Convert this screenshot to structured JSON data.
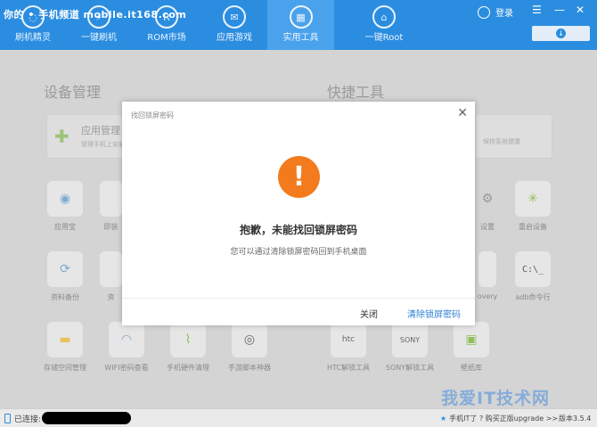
{
  "watermark": "你的 • 手机频道 mobile.it168.com",
  "nav": [
    {
      "label": "刷机精灵",
      "icon": "circle-icon"
    },
    {
      "label": "一键刷机",
      "icon": "flash-icon"
    },
    {
      "label": "ROM市场",
      "icon": "rom-icon"
    },
    {
      "label": "应用游戏",
      "icon": "mail-icon"
    },
    {
      "label": "实用工具",
      "icon": "grid-icon"
    },
    {
      "label": "一键Root",
      "icon": "root-icon"
    }
  ],
  "header": {
    "login_label": "登录"
  },
  "background": {
    "left_title": "设备管理",
    "right_title": "快捷工具",
    "card_title": "应用管理",
    "card_sub": "管理手机上安装",
    "right_card_sub": "保持系统健康",
    "tiles": [
      {
        "label": "应用宝",
        "icon": "app-store-icon"
      },
      {
        "label": "即装",
        "icon": "install-icon"
      },
      {
        "label": "资料备份",
        "icon": "backup-icon"
      },
      {
        "label": "资",
        "icon": "restore-icon"
      },
      {
        "label": "存储空间管理",
        "icon": "folder-icon"
      },
      {
        "label": "WIFI密码查看",
        "icon": "wifi-icon"
      },
      {
        "label": "手机硬件清理",
        "icon": "broom-icon"
      },
      {
        "label": "手游脚本神器",
        "icon": "gamepad-icon"
      },
      {
        "label": "HTC解锁工具",
        "icon": "htc-icon"
      },
      {
        "label": "SONY解锁工具",
        "icon": "sony-icon"
      },
      {
        "label": "壁纸库",
        "icon": "image-icon"
      },
      {
        "label": "设置",
        "icon": "settings-icon"
      },
      {
        "label": "重启设备",
        "icon": "restart-icon"
      },
      {
        "label": "overy",
        "icon": "recovery-icon"
      },
      {
        "label": "adb命令行",
        "icon": "terminal-icon"
      }
    ]
  },
  "modal": {
    "title": "找回锁屏密码",
    "message": "抱歉，未能找回锁屏密码",
    "sub_message": "您可以通过清除锁屏密码回到手机桌面",
    "close_button": "关闭",
    "clear_button": "清除锁屏密码"
  },
  "status": {
    "connected_label": "已连接:",
    "right_text": "手机IT了 ? 购买正版upgrade >>",
    "version": "版本3.5.4"
  },
  "brand_watermark": "我爱IT技术网"
}
